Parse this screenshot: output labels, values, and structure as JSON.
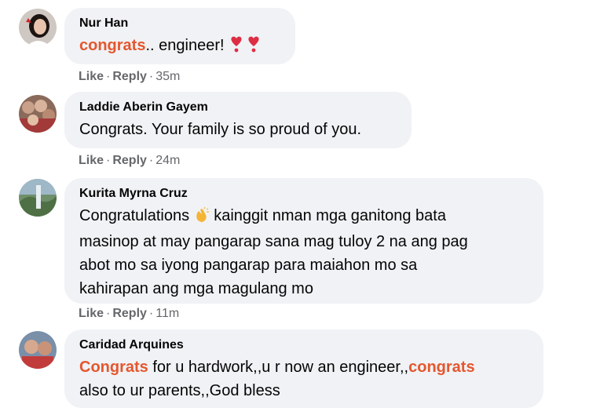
{
  "comments": [
    {
      "author": "Nur Han",
      "text_parts": [
        {
          "t": "congrats",
          "hl": true
        },
        {
          "t": ".. engineer! ",
          "hl": false
        }
      ],
      "emoji": [
        "heart-exclamation-icon",
        "heart-exclamation-icon"
      ],
      "like": "Like",
      "reply": "Reply",
      "time": "35m"
    },
    {
      "author": "Laddie Aberin Gayem",
      "text_lines": [
        "Congrats. Your family is so proud of you."
      ],
      "like": "Like",
      "reply": "Reply",
      "time": "24m"
    },
    {
      "author": "Kurita Myrna Cruz",
      "line1_a": "Congratulations ",
      "line1_b": " kainggit nman mga ganitong bata",
      "text_lines": [
        "masinop at may pangarap sana mag tuloy 2 na ang pag",
        "abot mo sa iyong pangarap para maiahon mo sa",
        "kahirapan ang mga magulang mo"
      ],
      "like": "Like",
      "reply": "Reply",
      "time": "11m"
    },
    {
      "author": "Caridad Arquines",
      "line1": [
        {
          "t": "Congrats",
          "hl": true
        },
        {
          "t": " for u hardwork,,u r now an engineer,,",
          "hl": false
        },
        {
          "t": "congrats",
          "hl": true
        }
      ],
      "line2": "also to ur parents,,God bless"
    }
  ],
  "colors": {
    "bubble": "#f0f2f5",
    "highlight": "#e4572e",
    "meta": "#65676b",
    "text": "#050505"
  }
}
